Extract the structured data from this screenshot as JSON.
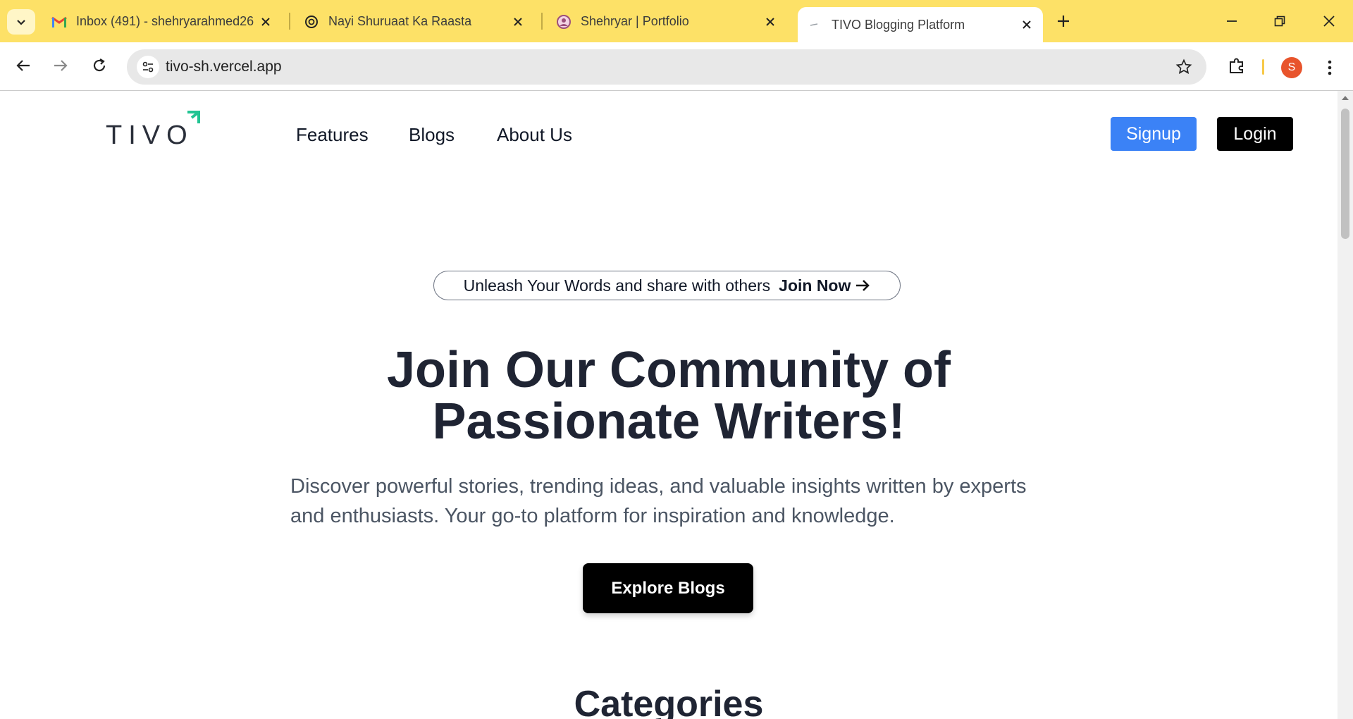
{
  "browser": {
    "tabs": [
      {
        "title": "Inbox (491) - shehryarahmed26",
        "favicon": "gmail-icon",
        "active": false
      },
      {
        "title": "Nayi Shuruaat Ka Raasta",
        "favicon": "openai-icon",
        "active": false
      },
      {
        "title": "Shehryar | Portfolio",
        "favicon": "portfolio-icon",
        "active": false
      },
      {
        "title": "TIVO Blogging Platform",
        "favicon": "tivo-favicon",
        "active": true
      }
    ],
    "url": "tivo-sh.vercel.app",
    "profile_initial": "S",
    "colors": {
      "tabstrip": "#fde167",
      "avatar": "#e8542c"
    }
  },
  "site": {
    "logo": "TIVO",
    "nav": {
      "features": "Features",
      "blogs": "Blogs",
      "about": "About Us"
    },
    "signup": "Signup",
    "login": "Login",
    "colors": {
      "signup": "#3b82f6",
      "login": "#000000",
      "logo_accent": "#22c493"
    }
  },
  "hero": {
    "pill_text": "Unleash Your Words and share with others",
    "pill_cta": "Join Now",
    "title": "Join Our Community of Passionate Writers!",
    "subtitle": "Discover powerful stories, trending ideas, and valuable insights written by experts and enthusiasts. Your go-to platform for inspiration and knowledge.",
    "button": "Explore Blogs"
  },
  "sections": {
    "categories_title": "Categories"
  }
}
